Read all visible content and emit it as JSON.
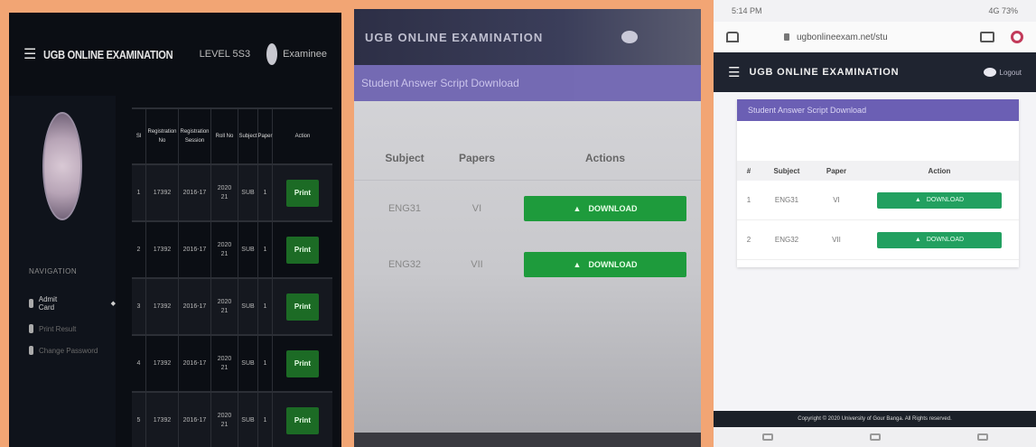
{
  "panel_desktop": {
    "brand": "UGB ONLINE EXAMINATION",
    "level": "LEVEL 5S3",
    "user": "Examinee",
    "section_label": "NAVIGATION",
    "nav_items": [
      {
        "label": "Admit Card",
        "active": true
      },
      {
        "label": "Print Result",
        "active": false
      },
      {
        "label": "Change Password",
        "active": false
      }
    ],
    "table_headers": [
      "Sl",
      "Registration No",
      "Registration Session",
      "Roll No",
      "Subject",
      "Paper",
      "Action"
    ],
    "rows": [
      {
        "sl": "1",
        "reg": "17392",
        "session": "2016-17",
        "roll": "2020\n21",
        "subject": "SUB",
        "paper": "1",
        "action": "Print"
      },
      {
        "sl": "2",
        "reg": "17392",
        "session": "2016-17",
        "roll": "2020\n21",
        "subject": "SUB",
        "paper": "1",
        "action": "Print"
      },
      {
        "sl": "3",
        "reg": "17392",
        "session": "2016-17",
        "roll": "2020\n21",
        "subject": "SUB",
        "paper": "1",
        "action": "Print"
      },
      {
        "sl": "4",
        "reg": "17392",
        "session": "2016-17",
        "roll": "2020\n21",
        "subject": "SUB",
        "paper": "1",
        "action": "Print"
      },
      {
        "sl": "5",
        "reg": "17392",
        "session": "2016-17",
        "roll": "2020\n21",
        "subject": "SUB",
        "paper": "1",
        "action": "Print"
      }
    ]
  },
  "panel_photo": {
    "brand": "UGB ONLINE EXAMINATION",
    "bar_title": "Student Answer Script Download",
    "headers": [
      "Subject",
      "Papers",
      "Actions"
    ],
    "rows": [
      {
        "subject": "ENG31",
        "paper": "VI",
        "action": "DOWNLOAD"
      },
      {
        "subject": "ENG32",
        "paper": "VII",
        "action": "DOWNLOAD"
      }
    ]
  },
  "panel_mobile": {
    "status_left": "5:14 PM",
    "status_right": "4G 73%",
    "url": "ugbonlineexam.net/stu",
    "brand": "UGB ONLINE EXAMINATION",
    "logout": "Logout",
    "card_title": "Student Answer Script Download",
    "headers": [
      "#",
      "Subject",
      "Paper",
      "Action"
    ],
    "rows": [
      {
        "n": "1",
        "subject": "ENG31",
        "paper": "VI",
        "action": "DOWNLOAD"
      },
      {
        "n": "2",
        "subject": "ENG32",
        "paper": "VII",
        "action": "DOWNLOAD"
      }
    ],
    "footer": "Copyright © 2020 University of Gour Banga. All Rights reserved."
  },
  "colors": {
    "frame": "#f2a574",
    "desktop_bg": "#0b0e14",
    "print_button": "#1c6b25",
    "download_button": "#1e9b3c",
    "purple_bar": "#6b5fb4",
    "navbar": "#1f2430"
  }
}
